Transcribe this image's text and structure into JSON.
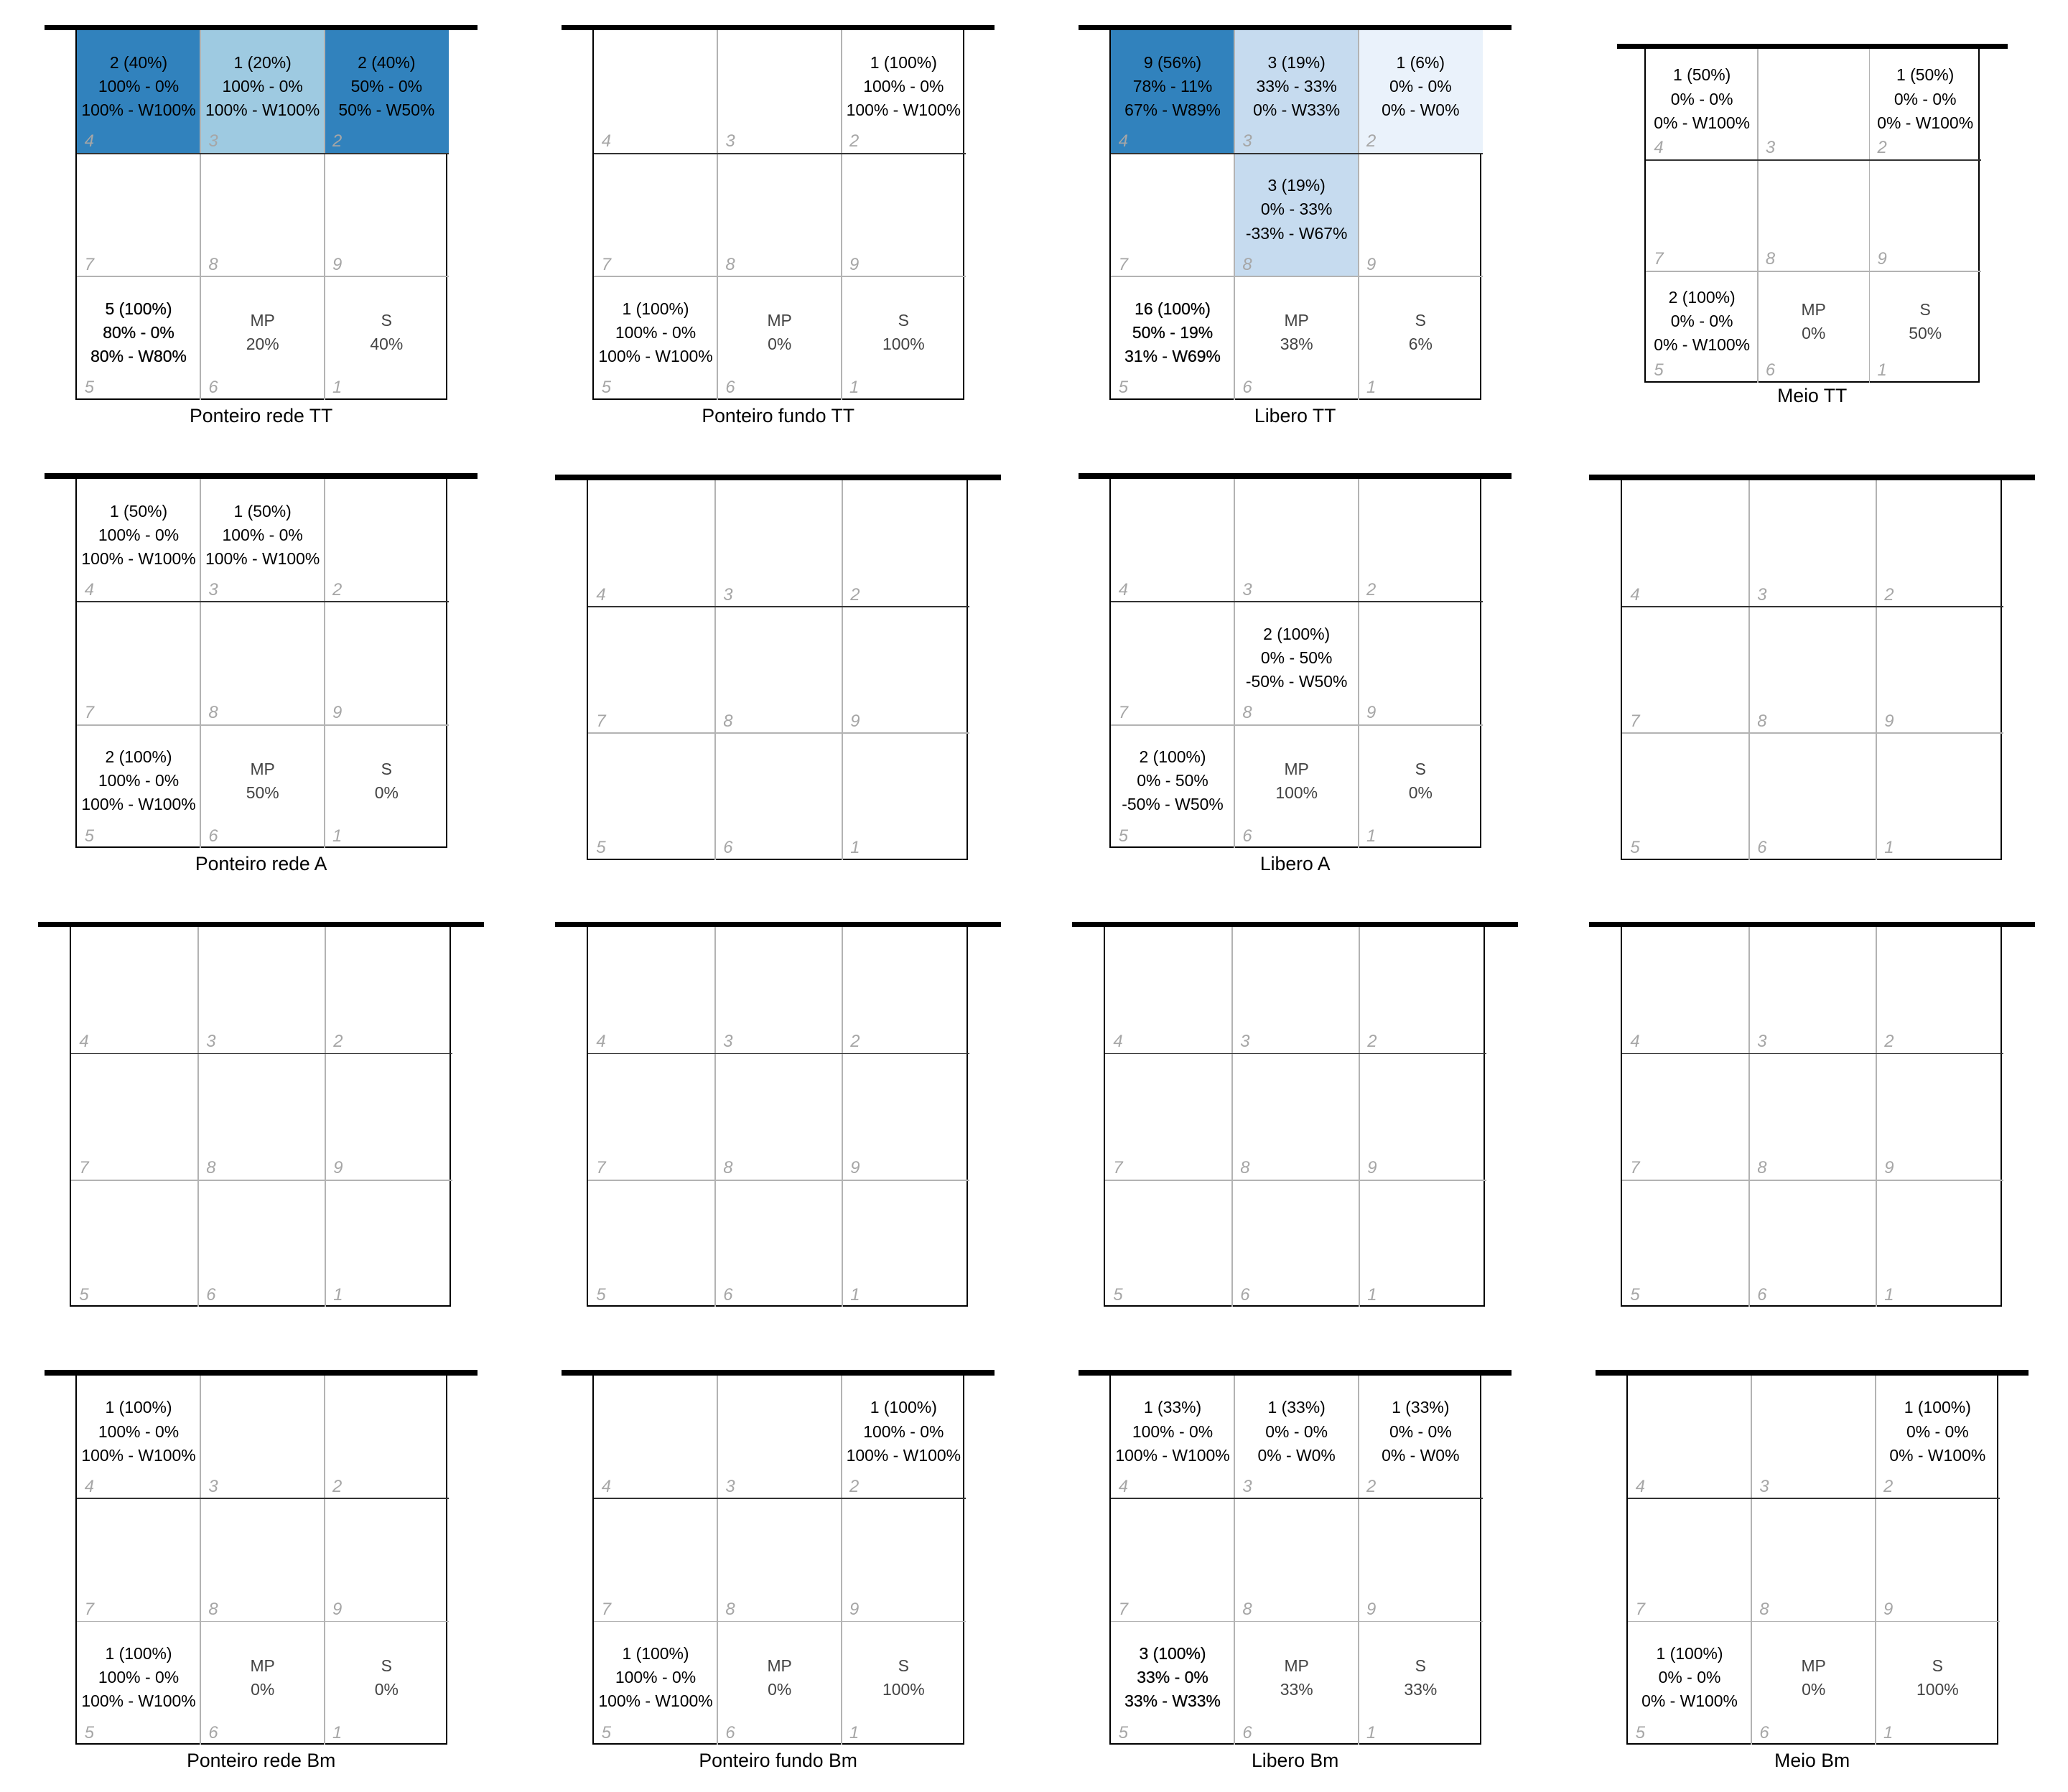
{
  "chart_data": {
    "type": "heatmap",
    "zone_numbers": [
      [
        "4",
        "3",
        "2"
      ],
      [
        "7",
        "8",
        "9"
      ],
      [
        "5",
        "6",
        "1"
      ]
    ],
    "colors": {
      "high": "#3182bd",
      "mid": "#9ecae1",
      "low": "#c6dbef",
      "lowest": "#eaf2fb"
    },
    "courts": [
      {
        "title": "Ponteiro rede TT",
        "cells": {
          "4": {
            "lines": [
              "2 (40%)",
              "100% - 0%",
              "100% - W100%"
            ],
            "shade": "high"
          },
          "3": {
            "lines": [
              "1 (20%)",
              "100% - 0%",
              "100% - W100%"
            ],
            "shade": "mid"
          },
          "2": {
            "lines": [
              "2 (40%)",
              "50% - 0%",
              "50% - W50%"
            ],
            "shade": "high"
          },
          "5": {
            "lines": [
              "5 (100%)",
              "80% - 0%",
              "80% - W80%"
            ],
            "bold": true
          },
          "6": {
            "lines": [
              "MP",
              "20%"
            ],
            "gray": true
          },
          "1": {
            "lines": [
              "S",
              "40%"
            ],
            "gray": true
          }
        }
      },
      {
        "title": "Ponteiro fundo TT",
        "cells": {
          "2": {
            "lines": [
              "1 (100%)",
              "100% - 0%",
              "100% - W100%"
            ]
          },
          "5": {
            "lines": [
              "1 (100%)",
              "100% - 0%",
              "100% - W100%"
            ]
          },
          "6": {
            "lines": [
              "MP",
              "0%"
            ],
            "gray": true
          },
          "1": {
            "lines": [
              "S",
              "100%"
            ],
            "gray": true
          }
        }
      },
      {
        "title": "Libero TT",
        "cells": {
          "4": {
            "lines": [
              "9 (56%)",
              "78% - 11%",
              "67% - W89%"
            ],
            "shade": "high"
          },
          "3": {
            "lines": [
              "3 (19%)",
              "33% - 33%",
              "0% - W33%"
            ],
            "shade": "low"
          },
          "2": {
            "lines": [
              "1 (6%)",
              "0% - 0%",
              "0% - W0%"
            ],
            "shade": "lowest"
          },
          "8": {
            "lines": [
              "3 (19%)",
              "0% - 33%",
              "-33% - W67%"
            ],
            "shade": "low"
          },
          "5": {
            "lines": [
              "16 (100%)",
              "50% - 19%",
              "31% - W69%"
            ],
            "bold": true
          },
          "6": {
            "lines": [
              "MP",
              "38%"
            ],
            "gray": true
          },
          "1": {
            "lines": [
              "S",
              "6%"
            ],
            "gray": true
          }
        }
      },
      {
        "title": "Meio TT",
        "cells": {
          "4": {
            "lines": [
              "1 (50%)",
              "0% - 0%",
              "0% - W100%"
            ]
          },
          "2": {
            "lines": [
              "1 (50%)",
              "0% - 0%",
              "0% - W100%"
            ]
          },
          "5": {
            "lines": [
              "2 (100%)",
              "0% - 0%",
              "0% - W100%"
            ]
          },
          "6": {
            "lines": [
              "MP",
              "0%"
            ],
            "gray": true
          },
          "1": {
            "lines": [
              "S",
              "50%"
            ],
            "gray": true
          }
        }
      },
      {
        "title": "Ponteiro rede A",
        "cells": {
          "4": {
            "lines": [
              "1 (50%)",
              "100% - 0%",
              "100% - W100%"
            ]
          },
          "3": {
            "lines": [
              "1 (50%)",
              "100% - 0%",
              "100% - W100%"
            ]
          },
          "5": {
            "lines": [
              "2 (100%)",
              "100% - 0%",
              "100% - W100%"
            ]
          },
          "6": {
            "lines": [
              "MP",
              "50%"
            ],
            "gray": true
          },
          "1": {
            "lines": [
              "S",
              "0%"
            ],
            "gray": true
          }
        }
      },
      {
        "title": "",
        "cells": {}
      },
      {
        "title": "Libero A",
        "cells": {
          "8": {
            "lines": [
              "2 (100%)",
              "0% - 50%",
              "-50% - W50%"
            ]
          },
          "5": {
            "lines": [
              "2 (100%)",
              "0% - 50%",
              "-50% - W50%"
            ]
          },
          "6": {
            "lines": [
              "MP",
              "100%"
            ],
            "gray": true
          },
          "1": {
            "lines": [
              "S",
              "0%"
            ],
            "gray": true
          }
        }
      },
      {
        "title": "",
        "cells": {}
      },
      {
        "title": "",
        "cells": {}
      },
      {
        "title": "",
        "cells": {}
      },
      {
        "title": "",
        "cells": {}
      },
      {
        "title": "",
        "cells": {}
      },
      {
        "title": "Ponteiro rede Bm",
        "cells": {
          "4": {
            "lines": [
              "1 (100%)",
              "100% - 0%",
              "100% - W100%"
            ]
          },
          "5": {
            "lines": [
              "1 (100%)",
              "100% - 0%",
              "100% - W100%"
            ]
          },
          "6": {
            "lines": [
              "MP",
              "0%"
            ],
            "gray": true
          },
          "1": {
            "lines": [
              "S",
              "0%"
            ],
            "gray": true
          }
        }
      },
      {
        "title": "Ponteiro fundo Bm",
        "cells": {
          "2": {
            "lines": [
              "1 (100%)",
              "100% - 0%",
              "100% - W100%"
            ]
          },
          "5": {
            "lines": [
              "1 (100%)",
              "100% - 0%",
              "100% - W100%"
            ]
          },
          "6": {
            "lines": [
              "MP",
              "0%"
            ],
            "gray": true
          },
          "1": {
            "lines": [
              "S",
              "100%"
            ],
            "gray": true
          }
        }
      },
      {
        "title": "Libero Bm",
        "cells": {
          "4": {
            "lines": [
              "1 (33%)",
              "100% - 0%",
              "100% - W100%"
            ]
          },
          "3": {
            "lines": [
              "1 (33%)",
              "0% - 0%",
              "0% - W0%"
            ]
          },
          "2": {
            "lines": [
              "1 (33%)",
              "0% - 0%",
              "0% - W0%"
            ]
          },
          "5": {
            "lines": [
              "3 (100%)",
              "33% - 0%",
              "33% - W33%"
            ],
            "bold": true
          },
          "6": {
            "lines": [
              "MP",
              "33%"
            ],
            "gray": true
          },
          "1": {
            "lines": [
              "S",
              "33%"
            ],
            "gray": true
          }
        }
      },
      {
        "title": "Meio Bm",
        "cells": {
          "2": {
            "lines": [
              "1 (100%)",
              "0% - 0%",
              "0% - W100%"
            ]
          },
          "5": {
            "lines": [
              "1 (100%)",
              "0% - 0%",
              "0% - W100%"
            ]
          },
          "6": {
            "lines": [
              "MP",
              "0%"
            ],
            "gray": true
          },
          "1": {
            "lines": [
              "S",
              "100%"
            ],
            "gray": true
          }
        }
      }
    ]
  }
}
